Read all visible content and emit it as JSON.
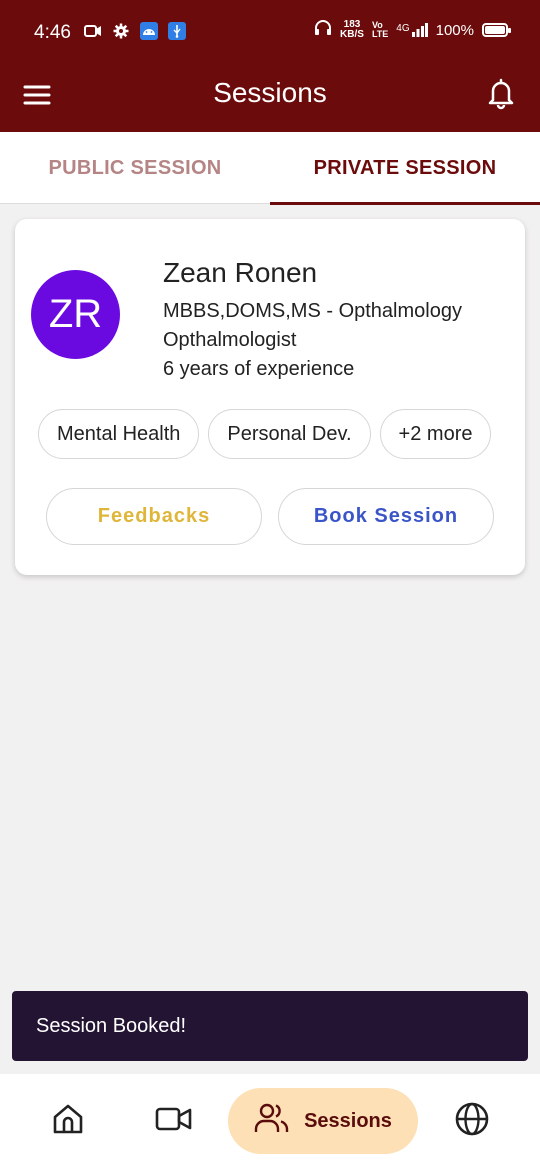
{
  "status_bar": {
    "time": "4:46",
    "net_speed_value": "183",
    "net_speed_unit": "KB/S",
    "network_label": "4G",
    "battery_text": "100%",
    "battery_level": 1.0
  },
  "app_bar": {
    "title": "Sessions",
    "menu_icon": "hamburger-menu-icon",
    "notification_icon": "bell-icon"
  },
  "tabs": [
    {
      "label": "PUBLIC SESSION",
      "selected": false
    },
    {
      "label": "PRIVATE SESSION",
      "selected": true
    }
  ],
  "doctor_card": {
    "avatar_initials": "ZR",
    "avatar_color": "#6a0ae0",
    "name": "Zean Ronen",
    "qualification": "MBBS,DOMS,MS - Opthalmology",
    "specialty": "Opthalmologist",
    "experience": "6 years of experience",
    "tags": [
      "Mental Health",
      "Personal Dev.",
      "+2 more"
    ],
    "feedback_label": "Feedbacks",
    "book_label": "Book Session"
  },
  "snackbar": {
    "message": "Session Booked!"
  },
  "bottom_nav": {
    "items": [
      {
        "icon": "home-icon",
        "label": "",
        "active": false
      },
      {
        "icon": "video-camera-icon",
        "label": "",
        "active": false
      },
      {
        "icon": "people-icon",
        "label": "Sessions",
        "active": true
      },
      {
        "icon": "globe-icon",
        "label": "",
        "active": false
      }
    ]
  },
  "colors": {
    "primary": "#6b0b0b",
    "active_nav_bg": "#fde0b5",
    "feedback_text": "#e0b63a",
    "book_text": "#3a55c8",
    "snackbar_bg": "#231433"
  }
}
